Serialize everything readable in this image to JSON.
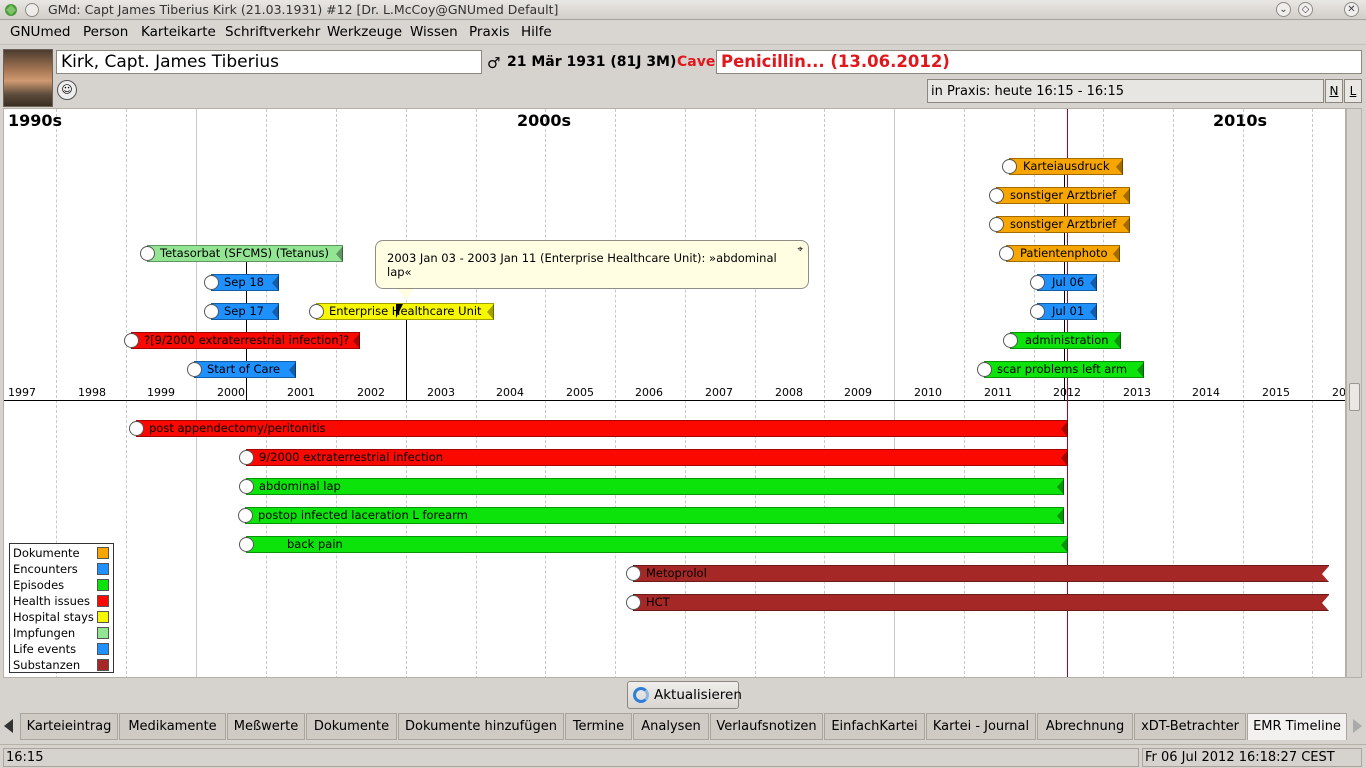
{
  "window": {
    "title": "GMd: Capt James Tiberius Kirk (21.03.1931) #12 [Dr. L.McCoy@GNUmed Default]"
  },
  "menu": [
    "GNUmed",
    "Person",
    "Karteikarte",
    "Schriftverkehr",
    "Werkzeuge",
    "Wissen",
    "Praxis",
    "Hilfe"
  ],
  "patient": {
    "name": "Kirk, Capt. James Tiberius",
    "gender_symbol": "♂",
    "dob": "21 Mär 1931 (81J 3M)",
    "cave_label": "Cave",
    "cave_value": "Penicillin... (13.06.2012)",
    "praxis_status": "in Praxis: heute 16:15 - 16:15",
    "btn_n": "N",
    "btn_l": "L"
  },
  "timeline": {
    "decades": [
      "1990s",
      "2000s",
      "2010s"
    ],
    "years": [
      "1997",
      "1998",
      "1999",
      "2000",
      "2001",
      "2002",
      "2003",
      "2004",
      "2005",
      "2006",
      "2007",
      "2008",
      "2009",
      "2010",
      "2011",
      "2012",
      "2013",
      "2014",
      "2015",
      "20"
    ],
    "events_above": [
      {
        "label": "Karteiausdruck",
        "category": "dok"
      },
      {
        "label": "sonstiger Arztbrief",
        "category": "dok"
      },
      {
        "label": "sonstiger Arztbrief",
        "category": "dok"
      },
      {
        "label": "Patientenphoto",
        "category": "dok"
      },
      {
        "label": "Jul 06",
        "category": "enc"
      },
      {
        "label": "Jul 01",
        "category": "enc"
      },
      {
        "label": "administration",
        "category": "epi"
      },
      {
        "label": "scar problems left arm",
        "category": "epi"
      },
      {
        "label": "Tetasorbat (SFCMS) (Tetanus)",
        "category": "imp"
      },
      {
        "label": "Sep 18",
        "category": "enc"
      },
      {
        "label": "Sep 17",
        "category": "enc"
      },
      {
        "label": "Enterprise Healthcare Unit",
        "category": "hos"
      },
      {
        "label": "?[9/2000 extraterrestrial infection]?",
        "category": "hea"
      },
      {
        "label": "Start of Care",
        "category": "lif"
      }
    ],
    "events_below": [
      {
        "label": "post appendectomy/peritonitis",
        "category": "hea"
      },
      {
        "label": "9/2000 extraterrestrial infection",
        "category": "hea"
      },
      {
        "label": "abdominal lap",
        "category": "epi"
      },
      {
        "label": "postop infected laceration L forearm",
        "category": "epi"
      },
      {
        "label": "back pain",
        "category": "epi"
      },
      {
        "label": "Metoprolol",
        "category": "sub"
      },
      {
        "label": "HCT",
        "category": "sub"
      }
    ],
    "tooltip": "2003 Jan 03 - 2003 Jan 11 (Enterprise Healthcare Unit): »abdominal lap«",
    "legend": [
      {
        "label": "Dokumente",
        "color": "#f7a500"
      },
      {
        "label": "Encounters",
        "color": "#1e90ff"
      },
      {
        "label": "Episodes",
        "color": "#0ce30b"
      },
      {
        "label": "Health issues",
        "color": "#fb0800"
      },
      {
        "label": "Hospital stays",
        "color": "#f7f700"
      },
      {
        "label": "Impfungen",
        "color": "#93e594"
      },
      {
        "label": "Life events",
        "color": "#1e90ff"
      },
      {
        "label": "Substanzen",
        "color": "#a62826"
      }
    ]
  },
  "refresh_label": "Aktualisieren",
  "tabs": [
    "Karteieintrag",
    "Medikamente",
    "Meßwerte",
    "Dokumente",
    "Dokumente hinzufügen",
    "Termine",
    "Analysen",
    "Verlaufsnotizen",
    "EinfachKartei",
    "Kartei - Journal",
    "Abrechnung",
    "xDT-Betrachter",
    "EMR Timeline"
  ],
  "active_tab": "EMR Timeline",
  "status": {
    "left": "16:15",
    "right": "Fr 06 Jul 2012 16:18:27 CEST"
  }
}
